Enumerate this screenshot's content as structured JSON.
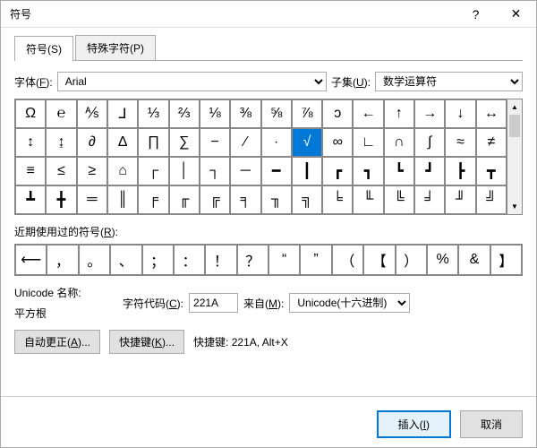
{
  "titlebar": {
    "title": "符号",
    "help": "?",
    "close": "✕"
  },
  "tabs": {
    "symbol": "符号(S)",
    "special": "特殊字符(P)"
  },
  "font": {
    "label": "字体(F):",
    "value": "Arial"
  },
  "subset": {
    "label": "子集(U):",
    "value": "数学运算符"
  },
  "symbols": {
    "row0": [
      "Ω",
      "℮",
      "⅍",
      "⅃",
      "⅓",
      "⅔",
      "⅛",
      "⅜",
      "⅝",
      "⅞",
      "ↄ",
      "←",
      "↑",
      "→",
      "↓",
      "↔"
    ],
    "row1": [
      "↕",
      "↨",
      "∂",
      "∆",
      "∏",
      "∑",
      "−",
      "∕",
      "∙",
      "√",
      "∞",
      "∟",
      "∩",
      "∫",
      "≈",
      "≠"
    ],
    "row2": [
      "≡",
      "≤",
      "≥",
      "⌂",
      "┌",
      "│",
      "┐",
      "─",
      "━",
      "┃",
      "┏",
      "┓",
      "┗",
      "┛",
      "┣",
      "┳"
    ],
    "row3": [
      "┻",
      "╋",
      "═",
      "║",
      "╒",
      "╓",
      "╔",
      "╕",
      "╖",
      "╗",
      "╘",
      "╙",
      "╚",
      "╛",
      "╜",
      "╝"
    ]
  },
  "selectedSymbol": "√",
  "recent": {
    "label": "近期使用过的符号(R):",
    "items": [
      "⟵",
      "，",
      "。",
      "、",
      "；",
      "：",
      "！",
      "？",
      "“",
      "”",
      "（",
      "【",
      "）",
      "%",
      "&",
      "】"
    ]
  },
  "unicode": {
    "nameLabel": "Unicode 名称:",
    "nameValue": "平方根"
  },
  "code": {
    "label": "字符代码(C):",
    "value": "221A"
  },
  "from": {
    "label": "来自(M):",
    "value": "Unicode(十六进制)"
  },
  "buttons": {
    "autocorrect": "自动更正(A)...",
    "shortcut": "快捷键(K)..."
  },
  "shortcutInfo": {
    "label": "快捷键:",
    "value": "221A, Alt+X"
  },
  "footer": {
    "insert": "插入(I)",
    "cancel": "取消"
  }
}
